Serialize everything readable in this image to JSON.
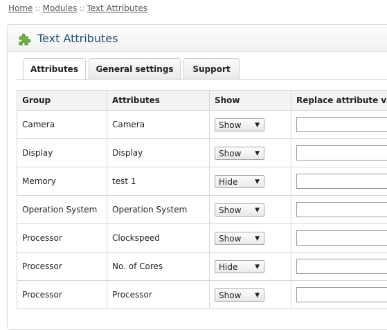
{
  "breadcrumb": {
    "items": [
      "Home",
      "Modules",
      "Text Attributes"
    ],
    "separator": "::"
  },
  "panel": {
    "title": "Text Attributes",
    "icon": "puzzle-icon"
  },
  "tabs": [
    {
      "label": "Attributes",
      "active": true
    },
    {
      "label": "General settings",
      "active": false
    },
    {
      "label": "Support",
      "active": false
    }
  ],
  "table": {
    "headers": [
      "Group",
      "Attributes",
      "Show",
      "Replace attribute value"
    ],
    "rows": [
      {
        "group": "Camera",
        "attribute": "Camera",
        "show": "Show",
        "replace": ""
      },
      {
        "group": "Display",
        "attribute": "Display",
        "show": "Show",
        "replace": ""
      },
      {
        "group": "Memory",
        "attribute": "test 1",
        "show": "Hide",
        "replace": ""
      },
      {
        "group": "Operation System",
        "attribute": "Operation System",
        "show": "Show",
        "replace": ""
      },
      {
        "group": "Processor",
        "attribute": "Clockspeed",
        "show": "Show",
        "replace": ""
      },
      {
        "group": "Processor",
        "attribute": "No. of Cores",
        "show": "Hide",
        "replace": ""
      },
      {
        "group": "Processor",
        "attribute": "Processor",
        "show": "Show",
        "replace": ""
      }
    ]
  },
  "colors": {
    "title": "#1e4e79",
    "icon": "#6cb33f"
  }
}
